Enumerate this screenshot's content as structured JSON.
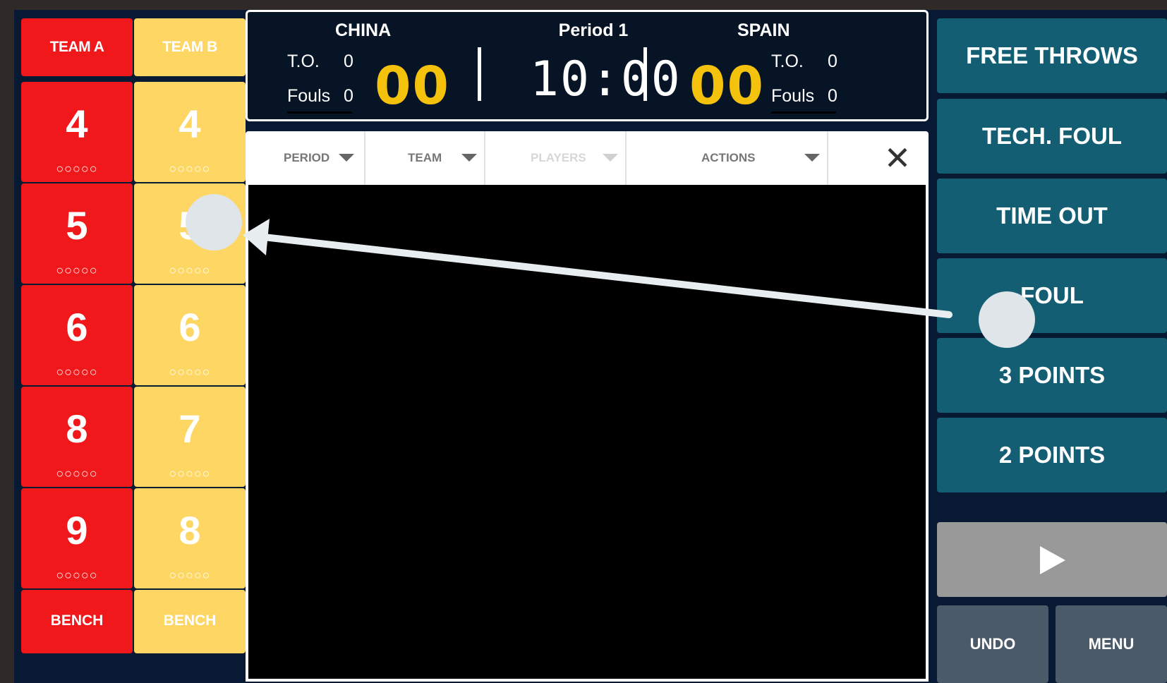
{
  "team_a": {
    "header": "TEAM A",
    "players": [
      {
        "number": "4",
        "fouls": "○○○○○"
      },
      {
        "number": "5",
        "fouls": "○○○○○"
      },
      {
        "number": "6",
        "fouls": "○○○○○"
      },
      {
        "number": "8",
        "fouls": "○○○○○"
      },
      {
        "number": "9",
        "fouls": "○○○○○"
      }
    ],
    "bench": "BENCH",
    "color": "#f0181a"
  },
  "team_b": {
    "header": "TEAM B",
    "players": [
      {
        "number": "4",
        "fouls": "○○○○○"
      },
      {
        "number": "5",
        "fouls": "○○○○○"
      },
      {
        "number": "6",
        "fouls": "○○○○○"
      },
      {
        "number": "7",
        "fouls": "○○○○○"
      },
      {
        "number": "8",
        "fouls": "○○○○○"
      }
    ],
    "bench": "BENCH",
    "color": "#fdd663"
  },
  "scoreboard": {
    "home_name": "CHINA",
    "away_name": "SPAIN",
    "period": "Period 1",
    "clock": "10:00",
    "home_score": "00",
    "away_score": "00",
    "to_label": "T.O.",
    "fouls_label": "Fouls",
    "home_to": "0",
    "home_fouls": "0",
    "away_to": "0",
    "away_fouls": "0",
    "score_color": "#f4c20d"
  },
  "filters": {
    "period": "PERIOD",
    "team": "TEAM",
    "players": "PLAYERS",
    "actions": "ACTIONS",
    "close": "✕"
  },
  "actions": {
    "free_throws": "FREE THROWS",
    "tech_foul": "TECH. FOUL",
    "time_out": "TIME OUT",
    "foul": "FOUL",
    "three_points": "3 POINTS",
    "two_points": "2 POINTS",
    "undo": "UNDO",
    "menu": "MENU"
  },
  "icons": {
    "play": "play-icon",
    "close": "close-icon",
    "caret": "caret-down-icon"
  }
}
